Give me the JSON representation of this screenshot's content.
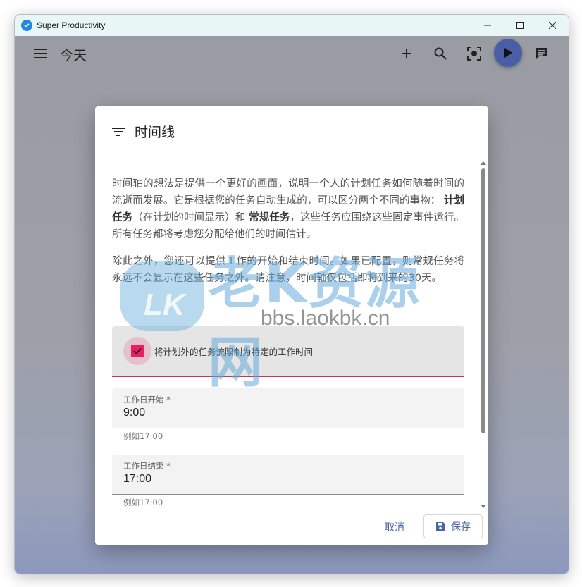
{
  "window": {
    "title": "Super Productivity"
  },
  "header": {
    "title": "今天"
  },
  "dialog": {
    "title": "时间线",
    "paragraph1": {
      "part1": "时间轴的想法是提供一个更好的画面，说明一个人的计划任务如何随着时间的流逝而发展。它是根据您的任务自动生成的，可以区分两个不同的事物：",
      "bold1": "计划任务",
      "part2": "（在计划的时间显示）和",
      "bold2": "常规任务",
      "part3": "，这些任务应围绕这些固定事件运行。所有任务都将考虑您分配给他们的时间估计。"
    },
    "paragraph2": "除此之外，您还可以提供工作的开始和结束时间。如果已配置，则常规任务将永远不会显示在这些任务之外。请注意，时间轴仅包括即将到来的30天。",
    "checkbox": {
      "label": "将计划外的任务流限制为特定的工作时间",
      "checked": true
    },
    "work_start": {
      "label": "工作日开始 *",
      "value": "9:00",
      "hint": "例如17:00"
    },
    "work_end": {
      "label": "工作日结束 *",
      "value": "17:00",
      "hint": "例如17:00"
    },
    "cancel_label": "取消",
    "save_label": "保存"
  },
  "watermark": {
    "text": "老K资源网",
    "badge": "LK",
    "url": "bbs.laokbk.cn"
  },
  "colors": {
    "accent": "#e91e63",
    "primary": "#4a64a8",
    "play_button": "#4a5ea6"
  }
}
